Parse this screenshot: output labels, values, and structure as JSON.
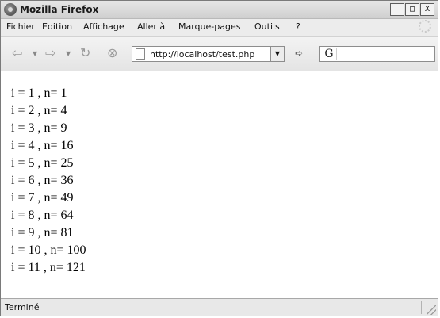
{
  "window": {
    "title": "Mozilla Firefox",
    "controls": {
      "minimize": "_",
      "maximize": "□",
      "close": "X"
    }
  },
  "menu": {
    "items": [
      {
        "label": "Fichier"
      },
      {
        "label": "Edition"
      },
      {
        "label": "Affichage"
      },
      {
        "label": "Aller à"
      },
      {
        "label": "Marque-pages"
      },
      {
        "label": "Outils"
      },
      {
        "label": "?"
      }
    ]
  },
  "toolbar": {
    "back_icon": "back-arrow-icon",
    "forward_icon": "forward-arrow-icon",
    "reload_icon": "reload-icon",
    "stop_icon": "stop-icon",
    "url": "http://localhost/test.php",
    "search_engine_icon": "google-icon",
    "search_value": ""
  },
  "content": {
    "lines": [
      "i = 1 , n= 1",
      "i = 2 , n= 4",
      "i = 3 , n= 9",
      "i = 4 , n= 16",
      "i = 5 , n= 25",
      "i = 6 , n= 36",
      "i = 7 , n= 49",
      "i = 8 , n= 64",
      "i = 9 , n= 81",
      "i = 10 , n= 100",
      "i = 11 , n= 121"
    ]
  },
  "status": {
    "text": "Terminé"
  }
}
